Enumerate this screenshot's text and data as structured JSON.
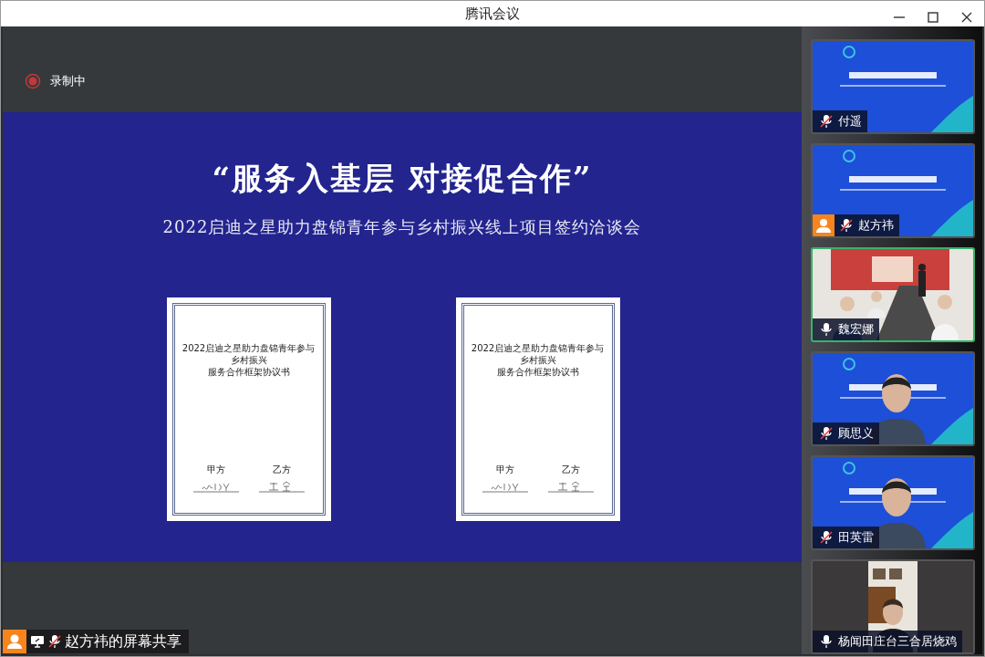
{
  "window": {
    "title": "腾讯会议"
  },
  "recording": {
    "label": "录制中"
  },
  "slide": {
    "title": "“服务入基层 对接促合作”",
    "subtitle": "2022启迪之星助力盘锦青年参与乡村振兴线上项目签约洽谈会",
    "documents": [
      {
        "title_lines": [
          "2022启迪之星助力盘锦青年参与乡村振兴",
          "服务合作框架协议书"
        ],
        "party_a": "甲方",
        "party_b": "乙方"
      },
      {
        "title_lines": [
          "2022启迪之星助力盘锦青年参与乡村振兴",
          "服务合作框架协议书"
        ],
        "party_a": "甲方",
        "party_b": "乙方"
      }
    ]
  },
  "participants": [
    {
      "name": "付遥",
      "muted": true,
      "avatar": false,
      "speaking": false,
      "kind": "slide"
    },
    {
      "name": "赵方祎",
      "muted": true,
      "avatar": true,
      "speaking": false,
      "kind": "slide"
    },
    {
      "name": "魏宏娜",
      "muted": false,
      "avatar": false,
      "speaking": true,
      "kind": "room"
    },
    {
      "name": "顾思义",
      "muted": true,
      "avatar": false,
      "speaking": false,
      "kind": "slide_person"
    },
    {
      "name": "田英雷",
      "muted": true,
      "avatar": false,
      "speaking": false,
      "kind": "slide_person"
    },
    {
      "name": "杨闻田庄台三合居烧鸡",
      "muted": false,
      "avatar": false,
      "speaking": false,
      "kind": "home"
    }
  ],
  "share_bar": {
    "label": "赵方祎的屏幕共享",
    "avatar": true,
    "muted": true
  }
}
